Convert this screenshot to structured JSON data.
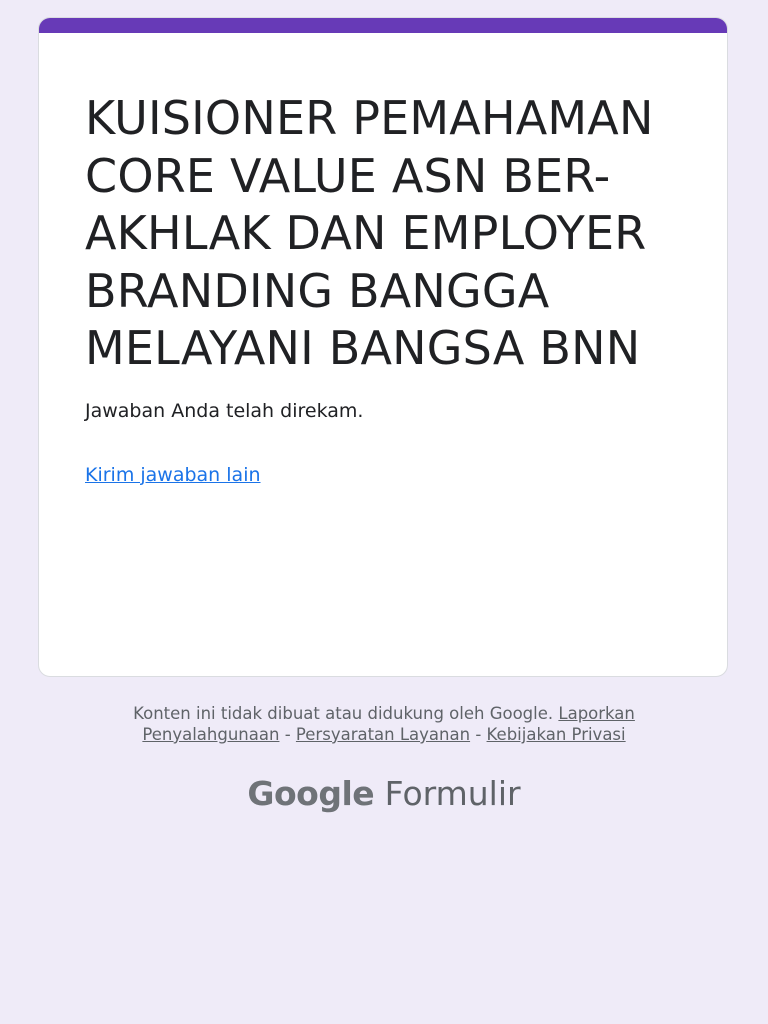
{
  "form": {
    "title": "KUISIONER PEMAHAMAN CORE VALUE ASN BER-AKHLAK DAN EMPLOYER BRANDING BANGGA MELAYANI BANGSA BNN",
    "confirmation": "Jawaban Anda telah direkam.",
    "submit_another_link": "Kirim jawaban lain"
  },
  "footer": {
    "disclaimer": "Konten ini tidak dibuat atau didukung oleh Google.",
    "report_link_1": "Laporkan",
    "report_link_2": "Penyalahgunaan",
    "separator": "-",
    "terms_link": "Persyaratan Layanan",
    "privacy_link": "Kebijakan Privasi"
  },
  "brand": {
    "google": "Google",
    "product": "Formulir"
  },
  "colors": {
    "accent": "#673ab7",
    "link": "#1a73e8",
    "background": "#efebf8"
  }
}
